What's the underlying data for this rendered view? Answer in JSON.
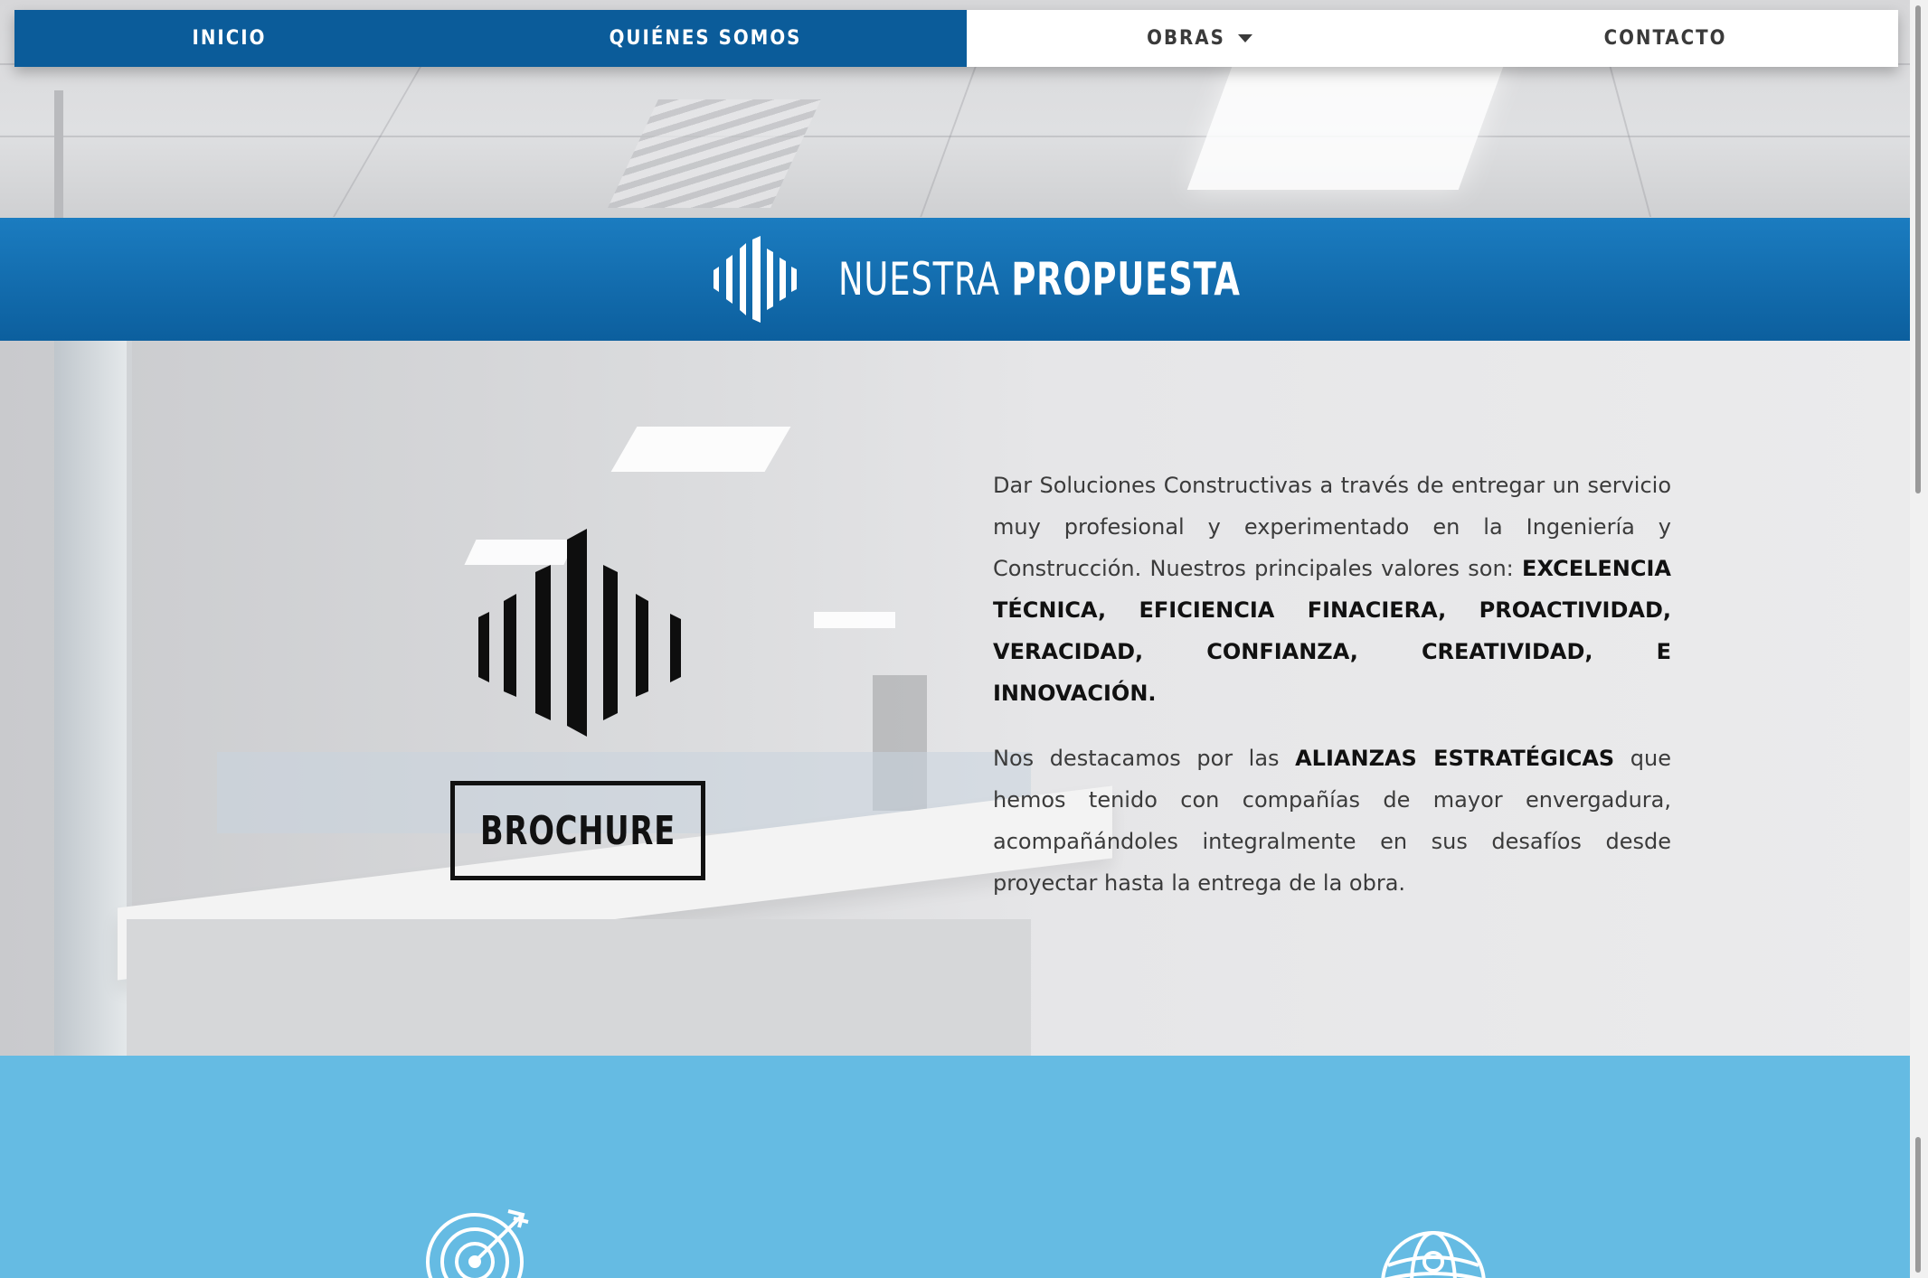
{
  "nav": {
    "items": [
      {
        "label": "INICIO",
        "active": true
      },
      {
        "label": "QUIÉNES SOMOS",
        "active": true
      },
      {
        "label": "OBRAS",
        "dropdown": true
      },
      {
        "label": "CONTACTO"
      }
    ]
  },
  "band": {
    "title_light": "NUESTRA",
    "title_bold": "PROPUESTA",
    "logo_icon": "sound-bars-logo-icon"
  },
  "main": {
    "brand_icon": "sound-bars-logo-icon",
    "brochure_label": "BROCHURE",
    "para1": {
      "intro": "Dar Soluciones Constructivas a través de entregar un servicio muy profesional y experimentado en la Ingeniería y Construcción. Nuestros principales valores son: ",
      "values": "EXCELENCIA TÉCNICA, EFICIENCIA FINACIERA, PROACTIVIDAD, VERACIDAD, CONFIANZA, CREATIVIDAD, E INNOVACIÓN."
    },
    "para2": {
      "before": "Nos destacamos por las ",
      "bold": "ALIANZAS ESTRATÉGICAS",
      "after": " que hemos tenido con compañías de mayor envergadura, acompañándoles integralmente en sus desafíos desde proyectar hasta la entrega de la obra."
    }
  },
  "lower": {
    "icons": [
      "target-arrow-icon",
      "globe-icon"
    ]
  },
  "colors": {
    "nav_blue": "#0b5c9a",
    "band_blue": "#1b7cc0",
    "lower_blue": "#65bbe3"
  }
}
